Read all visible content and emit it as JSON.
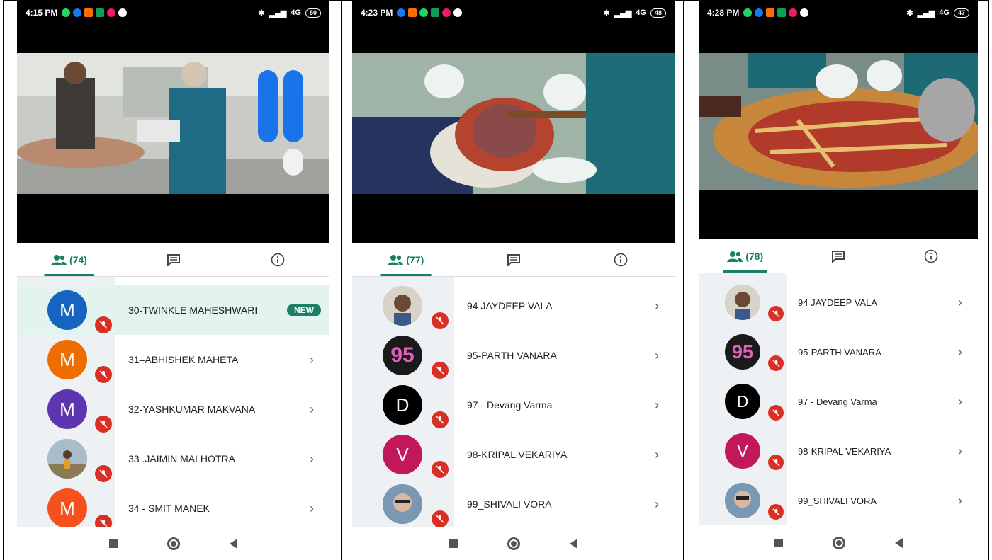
{
  "screens": [
    {
      "time": "4:15 PM",
      "network": "4G",
      "battery": "50",
      "participants_count": "(74)",
      "participants": [
        {
          "name": "30-TWINKLE MAHESHWARI",
          "avatar_letter": "M",
          "avatar_color": "#1565c0",
          "badge": "NEW"
        },
        {
          "name": "31–ABHISHEK MAHETA",
          "avatar_letter": "M",
          "avatar_color": "#ef6c00"
        },
        {
          "name": "32-YASHKUMAR MAKVANA",
          "avatar_letter": "M",
          "avatar_color": "#5e35b1"
        },
        {
          "name": "33 .JAIMIN MALHOTRA",
          "avatar_letter": "",
          "avatar_color": "#8d9c6a"
        },
        {
          "name": "34 - SMIT MANEK",
          "avatar_letter": "M",
          "avatar_color": "#f4511e"
        }
      ]
    },
    {
      "time": "4:23 PM",
      "network": "4G",
      "battery": "48",
      "participants_count": "(77)",
      "participants": [
        {
          "name": "94 JAYDEEP VALA",
          "avatar_letter": "",
          "avatar_color": "#b5a08a"
        },
        {
          "name": "95-PARTH VANARA",
          "avatar_letter": "95",
          "avatar_color": "#1a1a1a"
        },
        {
          "name": "97 - Devang Varma",
          "avatar_letter": "D",
          "avatar_color": "#000000"
        },
        {
          "name": "98-KRIPAL VEKARIYA",
          "avatar_letter": "V",
          "avatar_color": "#c2185b"
        },
        {
          "name": "99_SHIVALI VORA",
          "avatar_letter": "",
          "avatar_color": "#6f8aa3"
        }
      ]
    },
    {
      "time": "4:28 PM",
      "network": "4G",
      "battery": "47",
      "participants_count": "(78)",
      "participants": [
        {
          "name": "94 JAYDEEP VALA",
          "avatar_letter": "",
          "avatar_color": "#b5a08a"
        },
        {
          "name": "95-PARTH VANARA",
          "avatar_letter": "95",
          "avatar_color": "#1a1a1a"
        },
        {
          "name": "97 - Devang Varma",
          "avatar_letter": "D",
          "avatar_color": "#000000"
        },
        {
          "name": "98-KRIPAL VEKARIYA",
          "avatar_letter": "V",
          "avatar_color": "#c2185b"
        },
        {
          "name": "99_SHIVALI VORA",
          "avatar_letter": "",
          "avatar_color": "#6f8aa3"
        }
      ]
    }
  ],
  "icons": [
    "people-icon",
    "chat-icon",
    "info-icon",
    "mic-off-icon",
    "chevron-right-icon",
    "home-icon",
    "back-icon",
    "recents-icon"
  ],
  "accent_color": "#1a7f64",
  "mute_color": "#d93025"
}
